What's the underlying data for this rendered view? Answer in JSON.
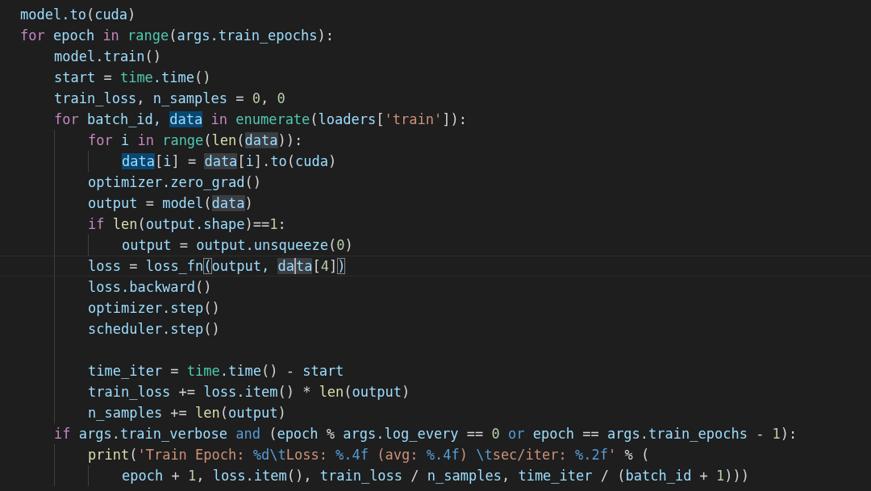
{
  "editor": {
    "lines": [
      {
        "tokens": [
          {
            "kind": "var",
            "text": "model.to"
          },
          {
            "kind": "plain",
            "text": "("
          },
          {
            "kind": "var",
            "text": "cuda"
          },
          {
            "kind": "plain",
            "text": ")"
          }
        ]
      },
      {
        "tokens": [
          {
            "kind": "kw",
            "text": "for "
          },
          {
            "kind": "var",
            "text": "epoch "
          },
          {
            "kind": "kw",
            "text": "in "
          },
          {
            "kind": "builtin",
            "text": "range"
          },
          {
            "kind": "plain",
            "text": "("
          },
          {
            "kind": "var",
            "text": "args.train_epochs"
          },
          {
            "kind": "plain",
            "text": "):"
          }
        ],
        "children": [
          {
            "tokens": [
              {
                "kind": "var",
                "text": "model.train"
              },
              {
                "kind": "plain",
                "text": "()"
              }
            ]
          },
          {
            "tokens": [
              {
                "kind": "var",
                "text": "start"
              },
              {
                "kind": "plain",
                "text": " = "
              },
              {
                "kind": "builtin",
                "text": "time"
              },
              {
                "kind": "var",
                "text": ".time"
              },
              {
                "kind": "plain",
                "text": "()"
              }
            ]
          },
          {
            "tokens": [
              {
                "kind": "var",
                "text": "train_loss"
              },
              {
                "kind": "plain",
                "text": ", "
              },
              {
                "kind": "var",
                "text": "n_samples"
              },
              {
                "kind": "plain",
                "text": " = "
              },
              {
                "kind": "num",
                "text": "0"
              },
              {
                "kind": "plain",
                "text": ", "
              },
              {
                "kind": "num",
                "text": "0"
              }
            ]
          },
          {
            "tokens": [
              {
                "kind": "kw",
                "text": "for "
              },
              {
                "kind": "var",
                "text": "batch_id, "
              },
              {
                "kind": "match-write",
                "text": "data"
              },
              {
                "kind": "kw",
                "text": " in "
              },
              {
                "kind": "builtin",
                "text": "enumerate"
              },
              {
                "kind": "plain",
                "text": "("
              },
              {
                "kind": "var",
                "text": "loaders"
              },
              {
                "kind": "plain",
                "text": "["
              },
              {
                "kind": "str",
                "text": "'train'"
              },
              {
                "kind": "plain",
                "text": "]):"
              }
            ],
            "children": [
              {
                "tokens": [
                  {
                    "kind": "kw",
                    "text": "for "
                  },
                  {
                    "kind": "var",
                    "text": "i "
                  },
                  {
                    "kind": "kw",
                    "text": "in "
                  },
                  {
                    "kind": "builtin",
                    "text": "range"
                  },
                  {
                    "kind": "plain",
                    "text": "("
                  },
                  {
                    "kind": "fn",
                    "text": "len"
                  },
                  {
                    "kind": "plain",
                    "text": "("
                  },
                  {
                    "kind": "match-read",
                    "text": "data"
                  },
                  {
                    "kind": "plain",
                    "text": ")):"
                  }
                ],
                "children": [
                  {
                    "tokens": [
                      {
                        "kind": "match-write",
                        "text": "data"
                      },
                      {
                        "kind": "plain",
                        "text": "["
                      },
                      {
                        "kind": "var",
                        "text": "i"
                      },
                      {
                        "kind": "plain",
                        "text": "] = "
                      },
                      {
                        "kind": "match-read",
                        "text": "data"
                      },
                      {
                        "kind": "plain",
                        "text": "["
                      },
                      {
                        "kind": "var",
                        "text": "i"
                      },
                      {
                        "kind": "plain",
                        "text": "]"
                      },
                      {
                        "kind": "var",
                        "text": ".to"
                      },
                      {
                        "kind": "plain",
                        "text": "("
                      },
                      {
                        "kind": "var",
                        "text": "cuda"
                      },
                      {
                        "kind": "plain",
                        "text": ")"
                      }
                    ]
                  }
                ]
              },
              {
                "tokens": [
                  {
                    "kind": "var",
                    "text": "optimizer.zero_grad"
                  },
                  {
                    "kind": "plain",
                    "text": "()"
                  }
                ]
              },
              {
                "tokens": [
                  {
                    "kind": "var",
                    "text": "output"
                  },
                  {
                    "kind": "plain",
                    "text": " = "
                  },
                  {
                    "kind": "var",
                    "text": "model"
                  },
                  {
                    "kind": "plain",
                    "text": "("
                  },
                  {
                    "kind": "match-read",
                    "text": "data"
                  },
                  {
                    "kind": "plain",
                    "text": ")"
                  }
                ]
              },
              {
                "tokens": [
                  {
                    "kind": "kw",
                    "text": "if "
                  },
                  {
                    "kind": "fn",
                    "text": "len"
                  },
                  {
                    "kind": "plain",
                    "text": "("
                  },
                  {
                    "kind": "var",
                    "text": "output.shape"
                  },
                  {
                    "kind": "plain",
                    "text": ")=="
                  },
                  {
                    "kind": "num",
                    "text": "1"
                  },
                  {
                    "kind": "plain",
                    "text": ":"
                  }
                ],
                "children": [
                  {
                    "tokens": [
                      {
                        "kind": "var",
                        "text": "output"
                      },
                      {
                        "kind": "plain",
                        "text": " = "
                      },
                      {
                        "kind": "var",
                        "text": "output.unsqueeze"
                      },
                      {
                        "kind": "plain",
                        "text": "("
                      },
                      {
                        "kind": "num",
                        "text": "0"
                      },
                      {
                        "kind": "plain",
                        "text": ")"
                      }
                    ]
                  }
                ]
              },
              {
                "current": true,
                "tokens": [
                  {
                    "kind": "var",
                    "text": "loss"
                  },
                  {
                    "kind": "plain",
                    "text": " = "
                  },
                  {
                    "kind": "var",
                    "text": "loss_fn"
                  },
                  {
                    "kind": "bracket",
                    "text": "("
                  },
                  {
                    "kind": "var",
                    "text": "output, "
                  },
                  {
                    "kind": "match-read-cursor",
                    "text": "da"
                  },
                  {
                    "kind": "match-read",
                    "text": "ta"
                  },
                  {
                    "kind": "plain",
                    "text": "["
                  },
                  {
                    "kind": "num",
                    "text": "4"
                  },
                  {
                    "kind": "plain",
                    "text": "]"
                  },
                  {
                    "kind": "bracket",
                    "text": ")"
                  }
                ]
              },
              {
                "tokens": [
                  {
                    "kind": "var",
                    "text": "loss.backward"
                  },
                  {
                    "kind": "plain",
                    "text": "()"
                  }
                ]
              },
              {
                "tokens": [
                  {
                    "kind": "var",
                    "text": "optimizer.step"
                  },
                  {
                    "kind": "plain",
                    "text": "()"
                  }
                ]
              },
              {
                "tokens": [
                  {
                    "kind": "var",
                    "text": "scheduler.step"
                  },
                  {
                    "kind": "plain",
                    "text": "()"
                  }
                ]
              },
              {
                "blank_before": true,
                "tokens": [
                  {
                    "kind": "var",
                    "text": "time_iter"
                  },
                  {
                    "kind": "plain",
                    "text": " = "
                  },
                  {
                    "kind": "builtin",
                    "text": "time"
                  },
                  {
                    "kind": "var",
                    "text": ".time"
                  },
                  {
                    "kind": "plain",
                    "text": "() - "
                  },
                  {
                    "kind": "var",
                    "text": "start"
                  }
                ]
              },
              {
                "tokens": [
                  {
                    "kind": "var",
                    "text": "train_loss"
                  },
                  {
                    "kind": "plain",
                    "text": " += "
                  },
                  {
                    "kind": "var",
                    "text": "loss.item"
                  },
                  {
                    "kind": "plain",
                    "text": "() * "
                  },
                  {
                    "kind": "fn",
                    "text": "len"
                  },
                  {
                    "kind": "plain",
                    "text": "("
                  },
                  {
                    "kind": "var",
                    "text": "output"
                  },
                  {
                    "kind": "plain",
                    "text": ")"
                  }
                ]
              },
              {
                "tokens": [
                  {
                    "kind": "var",
                    "text": "n_samples"
                  },
                  {
                    "kind": "plain",
                    "text": " += "
                  },
                  {
                    "kind": "fn",
                    "text": "len"
                  },
                  {
                    "kind": "plain",
                    "text": "("
                  },
                  {
                    "kind": "var",
                    "text": "output"
                  },
                  {
                    "kind": "plain",
                    "text": ")"
                  }
                ]
              }
            ]
          },
          {
            "tokens": [
              {
                "kind": "kw",
                "text": "if "
              },
              {
                "kind": "var",
                "text": "args.train_verbose "
              },
              {
                "kind": "op",
                "text": "and"
              },
              {
                "kind": "plain",
                "text": " ("
              },
              {
                "kind": "var",
                "text": "epoch"
              },
              {
                "kind": "plain",
                "text": " % "
              },
              {
                "kind": "var",
                "text": "args.log_every"
              },
              {
                "kind": "plain",
                "text": " == "
              },
              {
                "kind": "num",
                "text": "0"
              },
              {
                "kind": "op",
                "text": " or "
              },
              {
                "kind": "var",
                "text": "epoch"
              },
              {
                "kind": "plain",
                "text": " == "
              },
              {
                "kind": "var",
                "text": "args.train_epochs"
              },
              {
                "kind": "plain",
                "text": " - "
              },
              {
                "kind": "num",
                "text": "1"
              },
              {
                "kind": "plain",
                "text": "):"
              }
            ],
            "children": [
              {
                "tokens": [
                  {
                    "kind": "fn",
                    "text": "print"
                  },
                  {
                    "kind": "plain",
                    "text": "("
                  },
                  {
                    "kind": "str",
                    "text": "'Train Epoch: "
                  },
                  {
                    "kind": "op",
                    "text": "%d\\t"
                  },
                  {
                    "kind": "str",
                    "text": "Loss: "
                  },
                  {
                    "kind": "op",
                    "text": "%.4f"
                  },
                  {
                    "kind": "str",
                    "text": " (avg: "
                  },
                  {
                    "kind": "op",
                    "text": "%.4f"
                  },
                  {
                    "kind": "str",
                    "text": ") "
                  },
                  {
                    "kind": "op",
                    "text": "\\t"
                  },
                  {
                    "kind": "str",
                    "text": "sec/iter: "
                  },
                  {
                    "kind": "op",
                    "text": "%.2f"
                  },
                  {
                    "kind": "str",
                    "text": "'"
                  },
                  {
                    "kind": "plain",
                    "text": " % ("
                  }
                ],
                "children": [
                  {
                    "tokens": [
                      {
                        "kind": "var",
                        "text": "epoch"
                      },
                      {
                        "kind": "plain",
                        "text": " + "
                      },
                      {
                        "kind": "num",
                        "text": "1"
                      },
                      {
                        "kind": "plain",
                        "text": ", "
                      },
                      {
                        "kind": "var",
                        "text": "loss.item"
                      },
                      {
                        "kind": "plain",
                        "text": "(), "
                      },
                      {
                        "kind": "var",
                        "text": "train_loss"
                      },
                      {
                        "kind": "plain",
                        "text": " / "
                      },
                      {
                        "kind": "var",
                        "text": "n_samples"
                      },
                      {
                        "kind": "plain",
                        "text": ", "
                      },
                      {
                        "kind": "var",
                        "text": "time_iter"
                      },
                      {
                        "kind": "plain",
                        "text": " / ("
                      },
                      {
                        "kind": "var",
                        "text": "batch_id"
                      },
                      {
                        "kind": "plain",
                        "text": " + "
                      },
                      {
                        "kind": "num",
                        "text": "1"
                      },
                      {
                        "kind": "plain",
                        "text": ")))"
                      }
                    ]
                  }
                ]
              }
            ]
          }
        ]
      }
    ]
  }
}
